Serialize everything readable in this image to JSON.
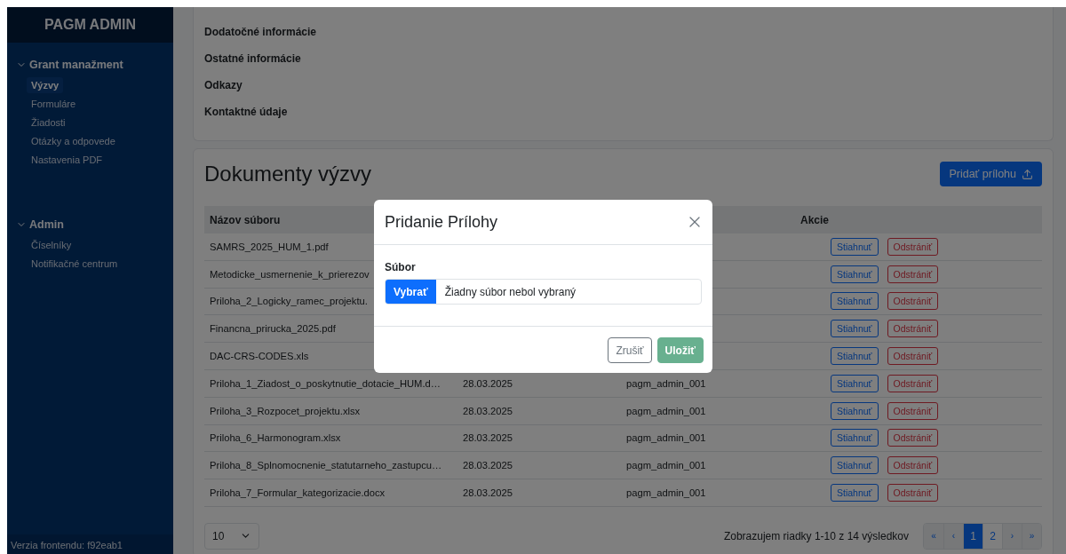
{
  "sidebar": {
    "brand": "PAGM ADMIN",
    "groups": [
      {
        "label": "Grant manažment",
        "expanded": true,
        "items": [
          {
            "label": "Výzvy",
            "selected": true
          },
          {
            "label": "Formuláre",
            "selected": false
          },
          {
            "label": "Žiadosti",
            "selected": false
          },
          {
            "label": "Otázky a odpovede",
            "selected": false
          },
          {
            "label": "Nastavenia PDF",
            "selected": false
          }
        ]
      },
      {
        "label": "Admin",
        "expanded": true,
        "items": [
          {
            "label": "Číselníky",
            "selected": false
          },
          {
            "label": "Notifikačné centrum",
            "selected": false
          }
        ]
      }
    ],
    "footer": "Verzia frontendu: f92eab1"
  },
  "info_sections": [
    "Dodatočné informácie",
    "Ostatné informácie",
    "Odkazy",
    "Kontaktné údaje"
  ],
  "documents": {
    "title": "Dokumenty výzvy",
    "add_button": "Pridať prílohu",
    "columns": [
      "Názov súboru",
      "Akcie"
    ],
    "rows": [
      {
        "name": "SAMRS_2025_HUM_1.pdf",
        "actions": [
          "Stiahnuť",
          "Odstrániť"
        ]
      },
      {
        "name": "Metodicke_usmernenie_k_prierezov",
        "actions": [
          "Stiahnuť",
          "Odstrániť"
        ]
      },
      {
        "name": "Priloha_2_Logicky_ramec_projektu.",
        "actions": [
          "Stiahnuť",
          "Odstrániť"
        ]
      },
      {
        "name": "Financna_prirucka_2025.pdf",
        "actions": [
          "Stiahnuť",
          "Odstrániť"
        ]
      },
      {
        "name": "DAC-CRS-CODES.xls",
        "actions": [
          "Stiahnuť",
          "Odstrániť"
        ]
      },
      {
        "name": "Priloha_1_Ziadost_o_poskytnutie_dotacie_HUM.d…",
        "date": "28.03.2025",
        "user": "pagm_admin_001",
        "actions": [
          "Stiahnuť",
          "Odstrániť"
        ]
      },
      {
        "name": "Priloha_3_Rozpocet_projektu.xlsx",
        "date": "28.03.2025",
        "user": "pagm_admin_001",
        "actions": [
          "Stiahnuť",
          "Odstrániť"
        ]
      },
      {
        "name": "Priloha_6_Harmonogram.xlsx",
        "date": "28.03.2025",
        "user": "pagm_admin_001",
        "actions": [
          "Stiahnuť",
          "Odstrániť"
        ]
      },
      {
        "name": "Priloha_8_Splnomocnenie_statutarneho_zastupcu…",
        "date": "28.03.2025",
        "user": "pagm_admin_001",
        "actions": [
          "Stiahnuť",
          "Odstrániť"
        ]
      },
      {
        "name": "Priloha_7_Formular_kategorizacie.docx",
        "date": "28.03.2025",
        "user": "pagm_admin_001",
        "actions": [
          "Stiahnuť",
          "Odstrániť"
        ]
      }
    ],
    "page_size": "10",
    "summary": "Zobrazujem riadky 1-10 z 14 výsledkov",
    "pagination": [
      {
        "label": "«",
        "kind": "nav",
        "selected": false
      },
      {
        "label": "‹",
        "kind": "nav",
        "selected": false
      },
      {
        "label": "1",
        "kind": "page",
        "selected": true
      },
      {
        "label": "2",
        "kind": "page",
        "selected": false
      },
      {
        "label": "›",
        "kind": "nav",
        "selected": false
      },
      {
        "label": "»",
        "kind": "nav",
        "selected": false
      }
    ]
  },
  "modal": {
    "title": "Pridanie Prílohy",
    "field_label": "Súbor",
    "browse_button": "Vybrať",
    "file_placeholder": "Žiadny súbor nebol vybraný",
    "buttons": [
      {
        "label": "Zrušiť",
        "kind": "secondary"
      },
      {
        "label": "Uložiť",
        "kind": "primary",
        "disabled": true
      }
    ]
  }
}
